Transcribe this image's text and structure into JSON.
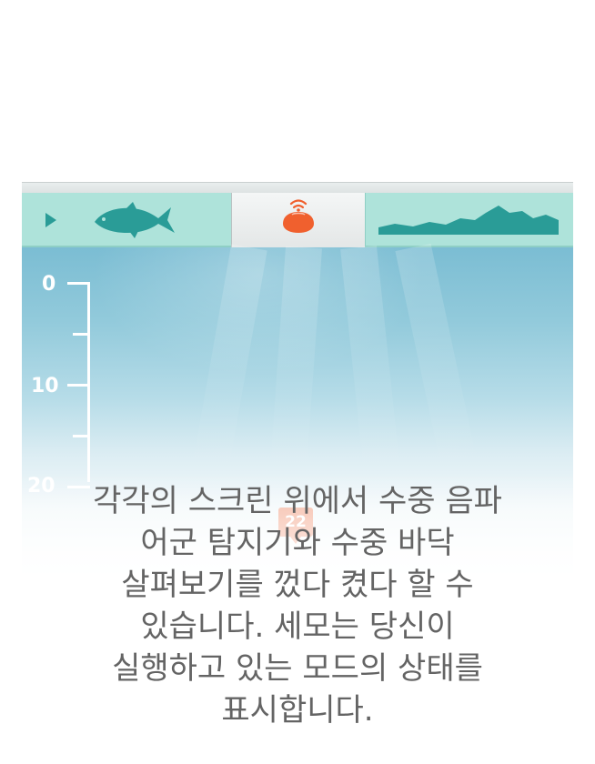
{
  "tabs": {
    "left": {
      "icons": [
        "play-arrow-icon",
        "fish-icon"
      ]
    },
    "center": {
      "icon": "sonar-device-icon"
    },
    "right": {
      "icon": "bottom-contour-icon"
    }
  },
  "sonar": {
    "depth_scale": [
      "0",
      "10",
      "20"
    ],
    "depth_marker": "22"
  },
  "caption": {
    "lines": [
      "각각의 스크린 위에서 수중 음파",
      "어군 탐지기와 수중 바닥",
      "살펴보기를 껐다 켰다 할 수",
      "있습니다. 세모는 당신이",
      "실행하고 있는 모드의 상태를",
      "표시합니다."
    ]
  },
  "colors": {
    "tab_teal": "#aee3da",
    "icon_teal": "#2a9c97",
    "device_orange": "#f0602e",
    "caption_text": "#646464"
  }
}
